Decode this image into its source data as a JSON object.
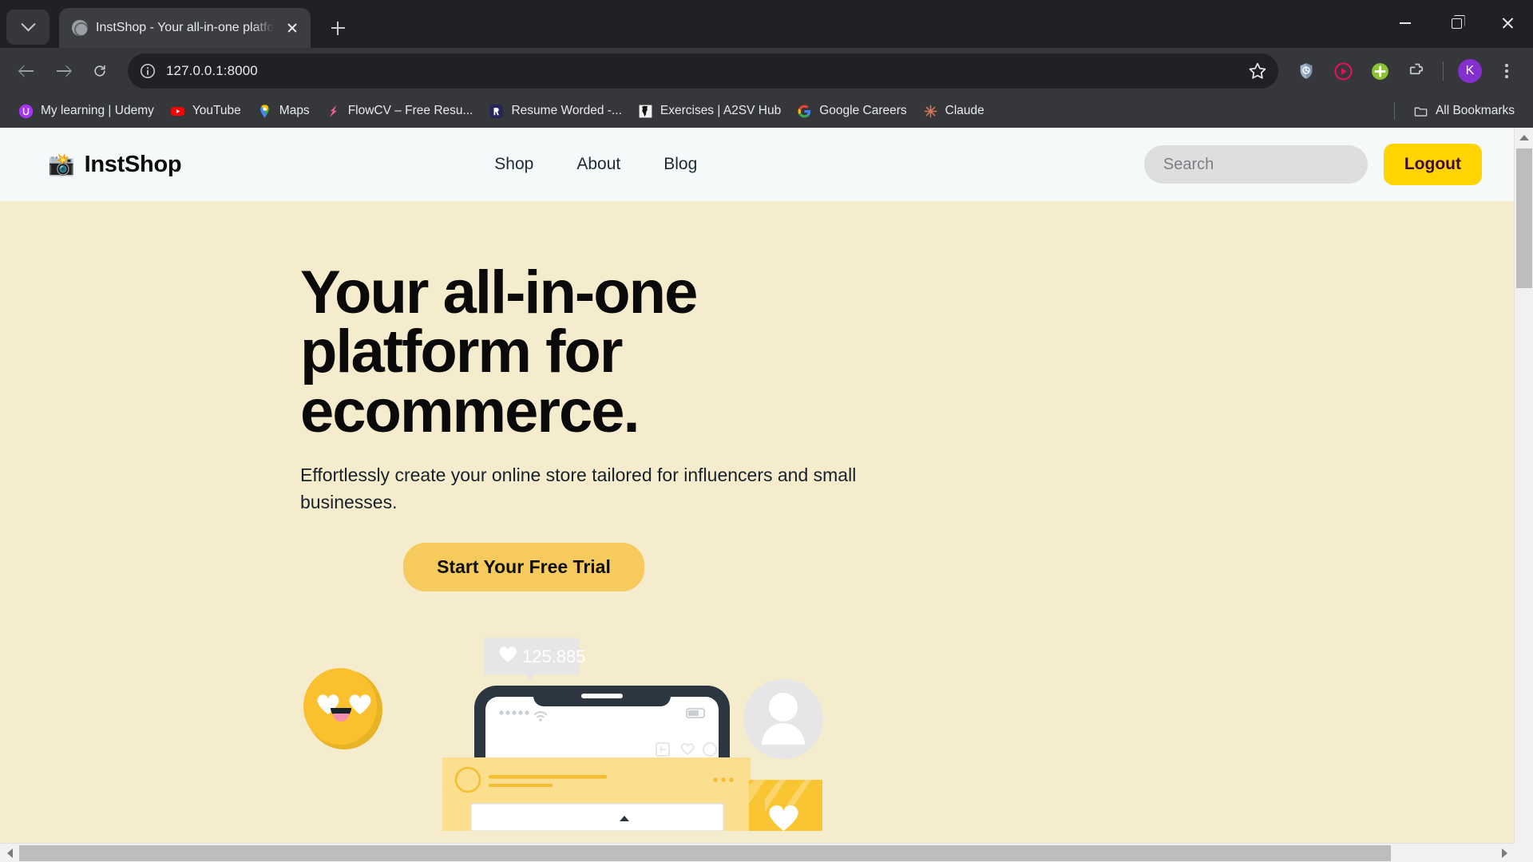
{
  "browser": {
    "tab": {
      "title": "InstShop - Your all-in-one platfo",
      "favicon": "globe-icon"
    },
    "tab_search_label": "Search tabs",
    "new_tab_label": "New Tab",
    "window_controls": {
      "minimize": "Minimize",
      "maximize": "Restore",
      "close": "Close"
    },
    "toolbar": {
      "back": "Back",
      "forward": "Forward",
      "reload": "Reload",
      "url": "127.0.0.1:8000",
      "site_info": "site-info-icon",
      "bookmark_star": "Bookmark this tab",
      "extensions": [
        {
          "name": "shield-icon",
          "color": "#9fb4c7"
        },
        {
          "name": "play-circle-icon",
          "color": "#e8115b"
        },
        {
          "name": "plus-circle-icon",
          "color": "#8bc334"
        },
        {
          "name": "puzzle-icon",
          "color": "#c8cacd"
        }
      ],
      "profile_initial": "K",
      "profile_color": "#8430ce",
      "menu": "Customize and control Google Chrome"
    },
    "bookmarks": [
      {
        "label": "My learning | Udemy",
        "icon": "udemy-icon"
      },
      {
        "label": "YouTube",
        "icon": "youtube-icon"
      },
      {
        "label": "Maps",
        "icon": "google-maps-icon"
      },
      {
        "label": "FlowCV – Free Resu...",
        "icon": "flowcv-icon"
      },
      {
        "label": "Resume Worded -...",
        "icon": "resume-worded-icon"
      },
      {
        "label": "Exercises | A2SV Hub",
        "icon": "a2sv-icon"
      },
      {
        "label": "Google Careers",
        "icon": "google-icon"
      },
      {
        "label": "Claude",
        "icon": "claude-icon"
      }
    ],
    "all_bookmarks_label": "All Bookmarks",
    "all_bookmarks_icon": "folder-icon"
  },
  "site": {
    "brand": {
      "logo": "📸",
      "name": "InstShop"
    },
    "nav_links": [
      {
        "label": "Shop"
      },
      {
        "label": "About"
      },
      {
        "label": "Blog"
      }
    ],
    "search": {
      "placeholder": "Search",
      "value": ""
    },
    "logout_label": "Logout",
    "hero": {
      "title_line1": "Your all-in-one",
      "title_line2": "platform for",
      "title_line3": "ecommerce.",
      "subtitle": "Effortlessly create your online store tailored for influencers and small businesses.",
      "cta_label": "Start Your Free Trial",
      "background_color": "#f5ebcd"
    },
    "illustration": {
      "likes_badge": "125.885",
      "likes_icon": "heart-icon",
      "emoji_face": "heart-eyes-face",
      "avatar": "user-avatar-placeholder",
      "card_heart": "white-heart-card",
      "post_menu": "..."
    },
    "colors": {
      "navbar_bg": "#f5f9fa",
      "hero_bg": "#f5ebcd",
      "accent_yellow": "#ffd400",
      "cta_yellow": "#f6ca5c",
      "logout_text": "#3b0a45"
    }
  },
  "scrollbars": {
    "vertical": "page-scrollbar-vertical",
    "horizontal": "page-scrollbar-horizontal"
  }
}
